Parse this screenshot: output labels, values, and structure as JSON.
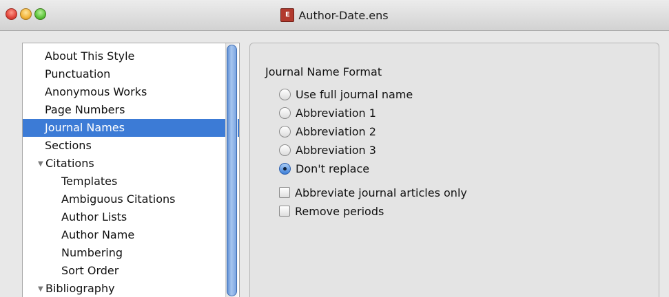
{
  "window": {
    "title": "Author-Date.ens",
    "icon": "endnote-style-file-icon"
  },
  "sidebar": {
    "items": [
      {
        "label": "About This Style"
      },
      {
        "label": "Punctuation"
      },
      {
        "label": "Anonymous Works"
      },
      {
        "label": "Page Numbers"
      },
      {
        "label": "Journal Names",
        "selected": true
      },
      {
        "label": "Sections"
      },
      {
        "label": "Citations",
        "expanded": true
      },
      {
        "label": "Templates"
      },
      {
        "label": "Ambiguous Citations"
      },
      {
        "label": "Author Lists"
      },
      {
        "label": "Author Name"
      },
      {
        "label": "Numbering"
      },
      {
        "label": "Sort Order"
      },
      {
        "label": "Bibliography",
        "expanded": true
      }
    ]
  },
  "panel": {
    "heading": "Journal Name Format",
    "radios": [
      {
        "label": "Use full journal name",
        "checked": false
      },
      {
        "label": "Abbreviation 1",
        "checked": false
      },
      {
        "label": "Abbreviation 2",
        "checked": false
      },
      {
        "label": "Abbreviation 3",
        "checked": false
      },
      {
        "label": "Don't replace",
        "checked": true
      }
    ],
    "checkboxes": [
      {
        "label": "Abbreviate journal articles only",
        "checked": false
      },
      {
        "label": "Remove periods",
        "checked": false
      }
    ]
  },
  "colors": {
    "selection": "#3c7bd6",
    "scroll_thumb": "#7aa4e0"
  }
}
